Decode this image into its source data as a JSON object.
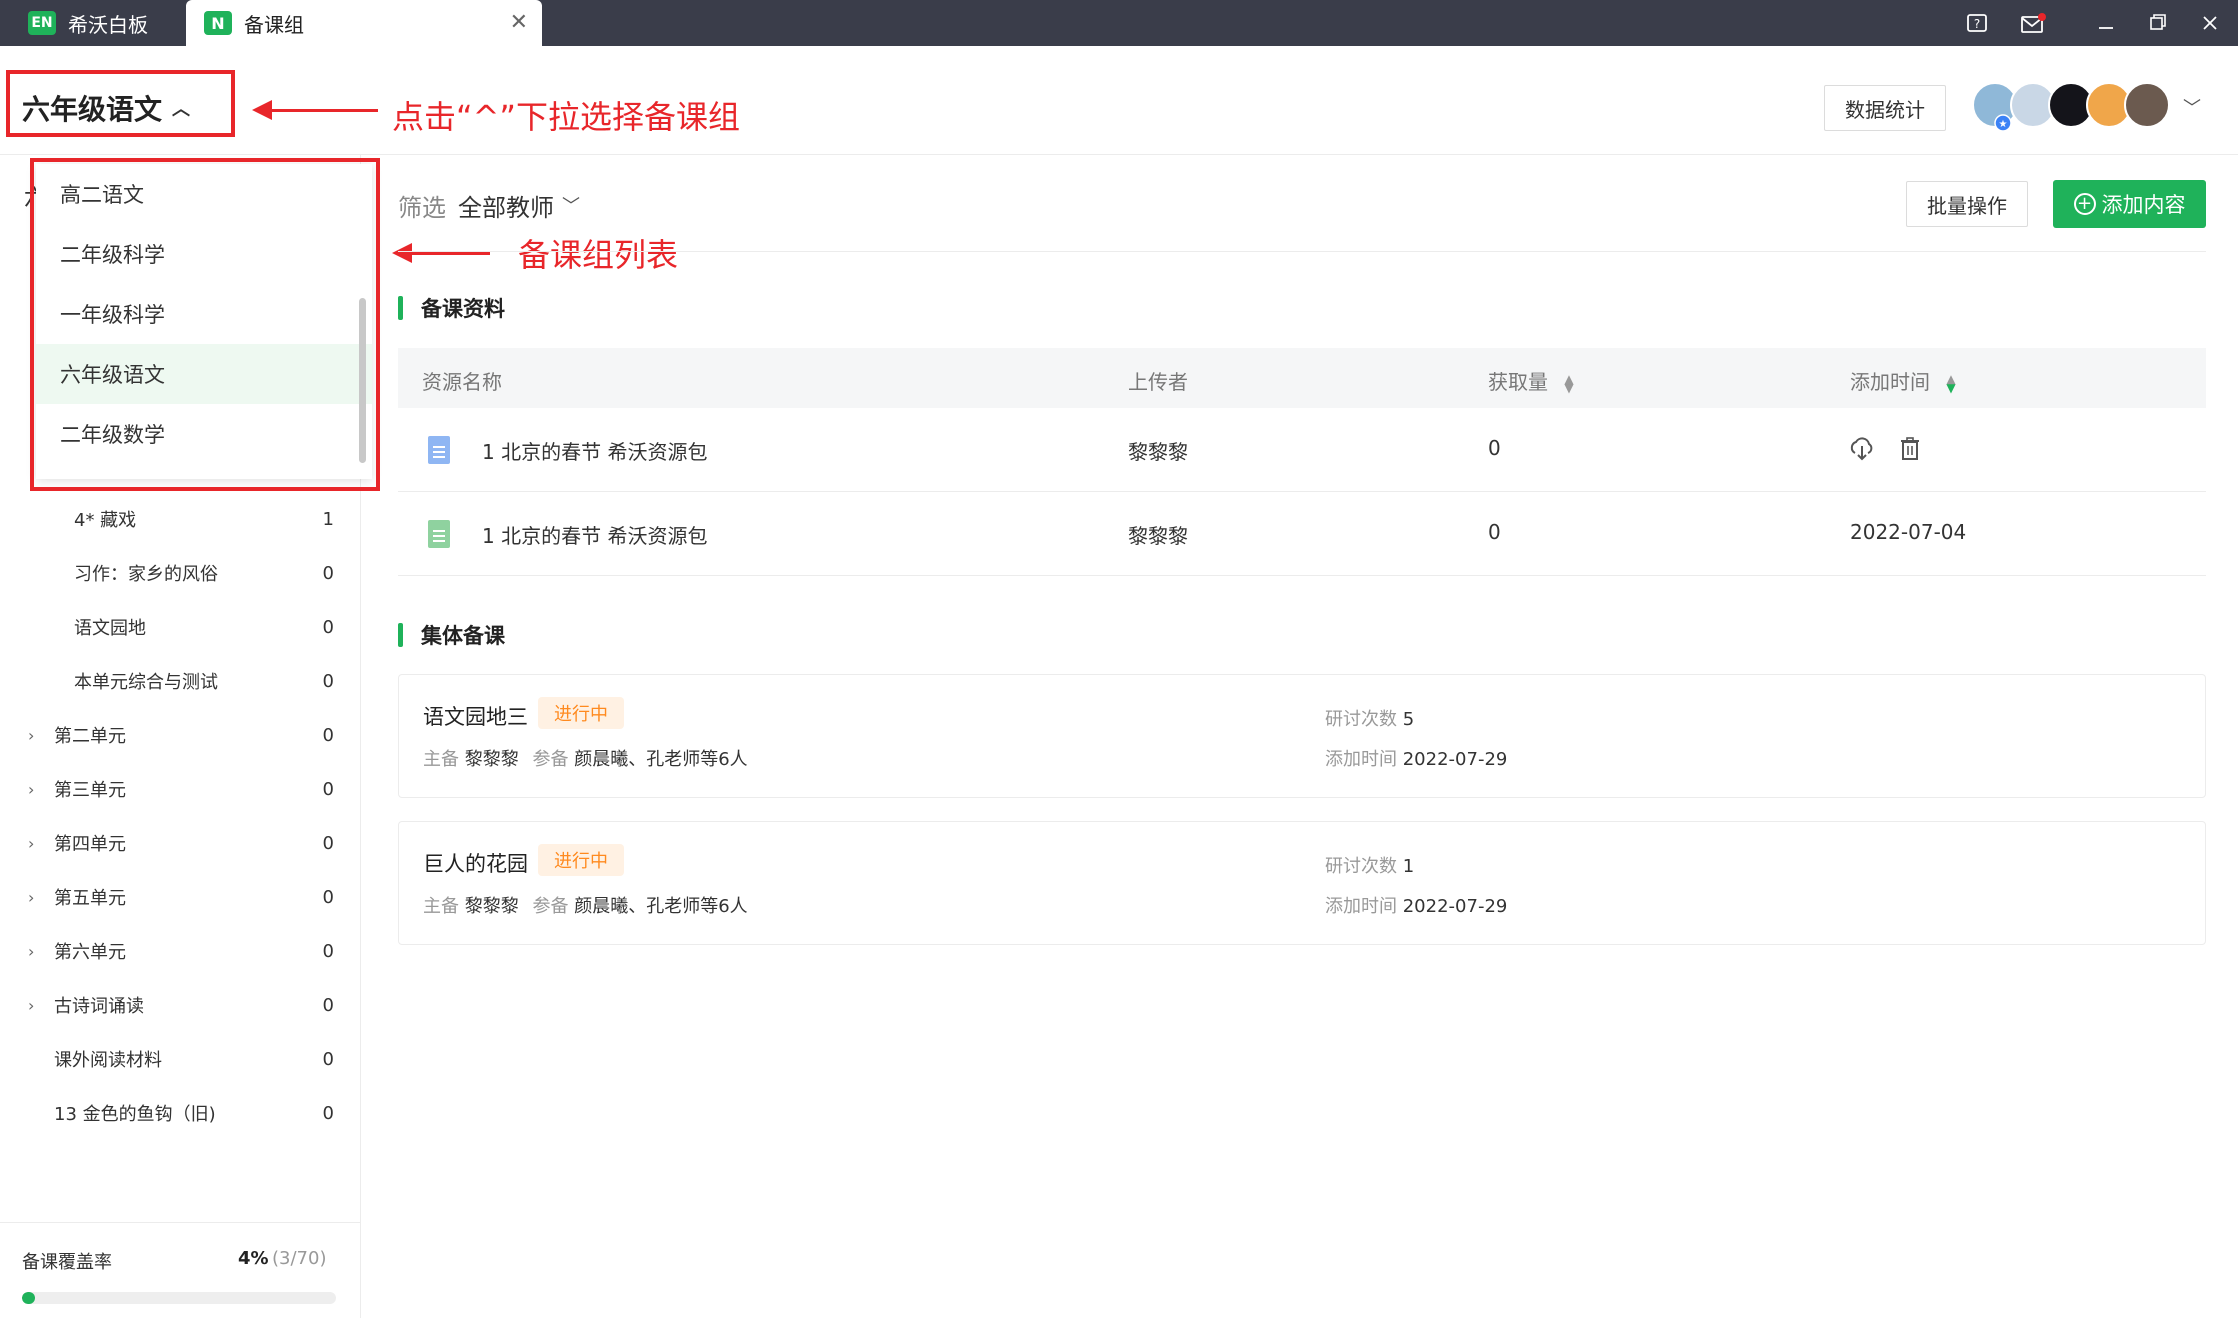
{
  "window": {
    "tabs": [
      {
        "logo": "EN",
        "label": "希沃白板"
      },
      {
        "logo": "N",
        "label": "备课组"
      }
    ]
  },
  "header": {
    "group_name": "六年级语文",
    "stats_label": "数据统计"
  },
  "annotations": {
    "top": "点击“^”下拉选择备课组",
    "list": "备课组列表"
  },
  "dropdown": {
    "items": [
      {
        "label": "高二语文"
      },
      {
        "label": "二年级科学"
      },
      {
        "label": "一年级科学"
      },
      {
        "label": "六年级语文"
      },
      {
        "label": "二年级数学"
      }
    ]
  },
  "sidebar": {
    "tree": [
      {
        "label": "4* 藏戏",
        "count": "1"
      },
      {
        "label": "习作：家乡的风俗",
        "count": "0"
      },
      {
        "label": "语文园地",
        "count": "0"
      },
      {
        "label": "本单元综合与测试",
        "count": "0"
      },
      {
        "label": "第二单元",
        "count": "0"
      },
      {
        "label": "第三单元",
        "count": "0"
      },
      {
        "label": "第四单元",
        "count": "0"
      },
      {
        "label": "第五单元",
        "count": "0"
      },
      {
        "label": "第六单元",
        "count": "0"
      },
      {
        "label": "古诗词诵读",
        "count": "0"
      },
      {
        "label": "课外阅读材料",
        "count": "0"
      },
      {
        "label": "13 金色的鱼钩（旧)",
        "count": "0"
      }
    ],
    "coverage": {
      "label": "备课覆盖率",
      "percent": "4%",
      "fraction": "(3/70)",
      "value": 4
    }
  },
  "main": {
    "filter": {
      "label": "筛选",
      "value": "全部教师"
    },
    "batch_label": "批量操作",
    "add_label": "添加内容",
    "resources": {
      "title": "备课资料",
      "columns": {
        "name": "资源名称",
        "uploader": "上传者",
        "count": "获取量",
        "time": "添加时间"
      },
      "rows": [
        {
          "name": "1 北京的春节 希沃资源包",
          "uploader": "黎黎黎",
          "count": "0",
          "time": ""
        },
        {
          "name": "1 北京的春节 希沃资源包",
          "uploader": "黎黎黎",
          "count": "0",
          "time": "2022-07-04"
        }
      ]
    },
    "collective": {
      "title": "集体备课",
      "cards": [
        {
          "title": "语文园地三",
          "status": "进行中",
          "host_label": "主备",
          "host": "黎黎黎",
          "members_label": "参备",
          "members": "颜晨曦、孔老师等6人",
          "sessions_label": "研讨次数",
          "sessions": "5",
          "added_label": "添加时间",
          "added": "2022-07-29"
        },
        {
          "title": "巨人的花园",
          "status": "进行中",
          "host_label": "主备",
          "host": "黎黎黎",
          "members_label": "参备",
          "members": "颜晨曦、孔老师等6人",
          "sessions_label": "研讨次数",
          "sessions": "1",
          "added_label": "添加时间",
          "added": "2022-07-29"
        }
      ]
    }
  }
}
